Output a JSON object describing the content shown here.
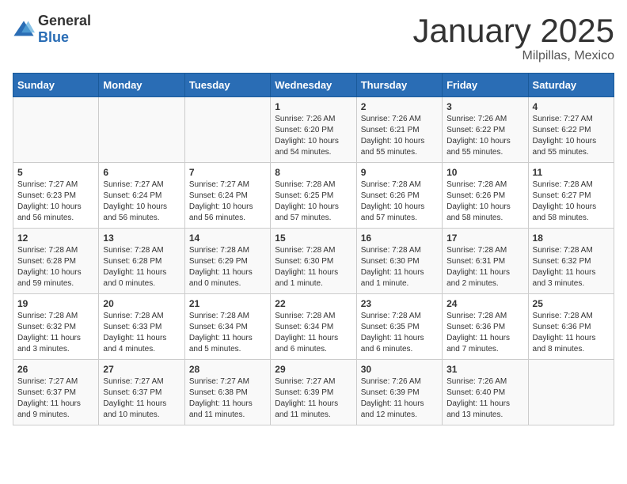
{
  "header": {
    "logo_general": "General",
    "logo_blue": "Blue",
    "title": "January 2025",
    "subtitle": "Milpillas, Mexico"
  },
  "weekdays": [
    "Sunday",
    "Monday",
    "Tuesday",
    "Wednesday",
    "Thursday",
    "Friday",
    "Saturday"
  ],
  "weeks": [
    [
      {
        "day": "",
        "info": ""
      },
      {
        "day": "",
        "info": ""
      },
      {
        "day": "",
        "info": ""
      },
      {
        "day": "1",
        "info": "Sunrise: 7:26 AM\nSunset: 6:20 PM\nDaylight: 10 hours and 54 minutes."
      },
      {
        "day": "2",
        "info": "Sunrise: 7:26 AM\nSunset: 6:21 PM\nDaylight: 10 hours and 55 minutes."
      },
      {
        "day": "3",
        "info": "Sunrise: 7:26 AM\nSunset: 6:22 PM\nDaylight: 10 hours and 55 minutes."
      },
      {
        "day": "4",
        "info": "Sunrise: 7:27 AM\nSunset: 6:22 PM\nDaylight: 10 hours and 55 minutes."
      }
    ],
    [
      {
        "day": "5",
        "info": "Sunrise: 7:27 AM\nSunset: 6:23 PM\nDaylight: 10 hours and 56 minutes."
      },
      {
        "day": "6",
        "info": "Sunrise: 7:27 AM\nSunset: 6:24 PM\nDaylight: 10 hours and 56 minutes."
      },
      {
        "day": "7",
        "info": "Sunrise: 7:27 AM\nSunset: 6:24 PM\nDaylight: 10 hours and 56 minutes."
      },
      {
        "day": "8",
        "info": "Sunrise: 7:28 AM\nSunset: 6:25 PM\nDaylight: 10 hours and 57 minutes."
      },
      {
        "day": "9",
        "info": "Sunrise: 7:28 AM\nSunset: 6:26 PM\nDaylight: 10 hours and 57 minutes."
      },
      {
        "day": "10",
        "info": "Sunrise: 7:28 AM\nSunset: 6:26 PM\nDaylight: 10 hours and 58 minutes."
      },
      {
        "day": "11",
        "info": "Sunrise: 7:28 AM\nSunset: 6:27 PM\nDaylight: 10 hours and 58 minutes."
      }
    ],
    [
      {
        "day": "12",
        "info": "Sunrise: 7:28 AM\nSunset: 6:28 PM\nDaylight: 10 hours and 59 minutes."
      },
      {
        "day": "13",
        "info": "Sunrise: 7:28 AM\nSunset: 6:28 PM\nDaylight: 11 hours and 0 minutes."
      },
      {
        "day": "14",
        "info": "Sunrise: 7:28 AM\nSunset: 6:29 PM\nDaylight: 11 hours and 0 minutes."
      },
      {
        "day": "15",
        "info": "Sunrise: 7:28 AM\nSunset: 6:30 PM\nDaylight: 11 hours and 1 minute."
      },
      {
        "day": "16",
        "info": "Sunrise: 7:28 AM\nSunset: 6:30 PM\nDaylight: 11 hours and 1 minute."
      },
      {
        "day": "17",
        "info": "Sunrise: 7:28 AM\nSunset: 6:31 PM\nDaylight: 11 hours and 2 minutes."
      },
      {
        "day": "18",
        "info": "Sunrise: 7:28 AM\nSunset: 6:32 PM\nDaylight: 11 hours and 3 minutes."
      }
    ],
    [
      {
        "day": "19",
        "info": "Sunrise: 7:28 AM\nSunset: 6:32 PM\nDaylight: 11 hours and 3 minutes."
      },
      {
        "day": "20",
        "info": "Sunrise: 7:28 AM\nSunset: 6:33 PM\nDaylight: 11 hours and 4 minutes."
      },
      {
        "day": "21",
        "info": "Sunrise: 7:28 AM\nSunset: 6:34 PM\nDaylight: 11 hours and 5 minutes."
      },
      {
        "day": "22",
        "info": "Sunrise: 7:28 AM\nSunset: 6:34 PM\nDaylight: 11 hours and 6 minutes."
      },
      {
        "day": "23",
        "info": "Sunrise: 7:28 AM\nSunset: 6:35 PM\nDaylight: 11 hours and 6 minutes."
      },
      {
        "day": "24",
        "info": "Sunrise: 7:28 AM\nSunset: 6:36 PM\nDaylight: 11 hours and 7 minutes."
      },
      {
        "day": "25",
        "info": "Sunrise: 7:28 AM\nSunset: 6:36 PM\nDaylight: 11 hours and 8 minutes."
      }
    ],
    [
      {
        "day": "26",
        "info": "Sunrise: 7:27 AM\nSunset: 6:37 PM\nDaylight: 11 hours and 9 minutes."
      },
      {
        "day": "27",
        "info": "Sunrise: 7:27 AM\nSunset: 6:37 PM\nDaylight: 11 hours and 10 minutes."
      },
      {
        "day": "28",
        "info": "Sunrise: 7:27 AM\nSunset: 6:38 PM\nDaylight: 11 hours and 11 minutes."
      },
      {
        "day": "29",
        "info": "Sunrise: 7:27 AM\nSunset: 6:39 PM\nDaylight: 11 hours and 11 minutes."
      },
      {
        "day": "30",
        "info": "Sunrise: 7:26 AM\nSunset: 6:39 PM\nDaylight: 11 hours and 12 minutes."
      },
      {
        "day": "31",
        "info": "Sunrise: 7:26 AM\nSunset: 6:40 PM\nDaylight: 11 hours and 13 minutes."
      },
      {
        "day": "",
        "info": ""
      }
    ]
  ]
}
